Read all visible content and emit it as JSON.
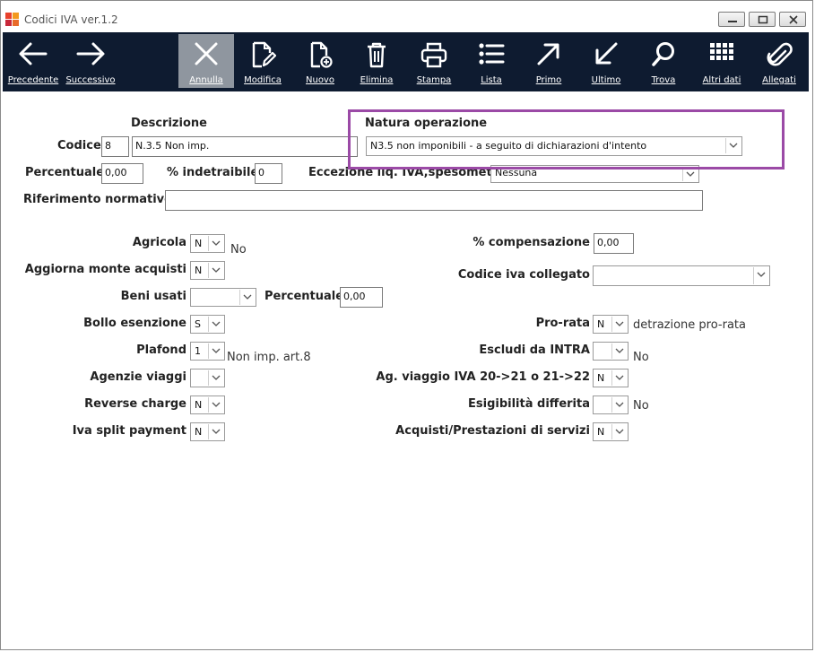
{
  "window": {
    "title": "Codici IVA ver.1.2"
  },
  "toolbar": {
    "precedente": "Precedente",
    "successivo": "Successivo",
    "annulla": "Annulla",
    "modifica": "Modifica",
    "nuovo": "Nuovo",
    "elimina": "Elimina",
    "stampa": "Stampa",
    "lista": "Lista",
    "primo": "Primo",
    "ultimo": "Ultimo",
    "trova": "Trova",
    "altri_dati": "Altri dati",
    "allegati": "Allegati"
  },
  "form": {
    "descrizione_label": "Descrizione",
    "codice_label": "Codice",
    "codice_value": "8",
    "descrizione_value": "N.3.5 Non imp.",
    "natura_label": "Natura operazione",
    "natura_value": "N3.5 non imponibili - a seguito di dichiarazioni d'intento",
    "percentuale_label": "Percentuale",
    "percentuale_value": "0,00",
    "indetraibile_label": "% indetraibile",
    "indetraibile_value": "0",
    "eccezione_label": "Eccezione liq. IVA,spesometro",
    "eccezione_value": "Nessuna",
    "riferimento_label": "Riferimento normativo",
    "riferimento_value": "",
    "agricola_label": "Agricola",
    "agricola_value": "N",
    "agricola_text": "No",
    "aggiorna_label": "Aggiorna monte acquisti",
    "aggiorna_value": "N",
    "beni_label": "Beni usati",
    "beni_value": "",
    "percentuale2_label": "Percentuale",
    "percentuale2_value": "0,00",
    "bollo_label": "Bollo esenzione",
    "bollo_value": "S",
    "plafond_label": "Plafond",
    "plafond_value": "1",
    "plafond_text": "Non imp. art.8",
    "agenzie_label": "Agenzie viaggi",
    "agenzie_value": "",
    "reverse_label": "Reverse charge",
    "reverse_value": "N",
    "split_label": "Iva split payment",
    "split_value": "N",
    "compensazione_label": "% compensazione",
    "compensazione_value": "0,00",
    "collegato_label": "Codice iva collegato",
    "collegato_value": "",
    "prorata_label": "Pro-rata",
    "prorata_value": "N",
    "prorata_text": "detrazione pro-rata",
    "intra_label": "Escludi da INTRA",
    "intra_value": "",
    "intra_text": "No",
    "agviaggio_label": "Ag. viaggio IVA 20->21 o 21->22",
    "agviaggio_value": "N",
    "esigibilita_label": "Esigibilità differita",
    "esigibilita_value": "",
    "esigibilita_text": "No",
    "acquisti_label": "Acquisti/Prestazioni di servizi",
    "acquisti_value": "N"
  },
  "colors": {
    "toolbar_bg": "#0e1b30",
    "active_button": "#8f969f",
    "highlight": "#9b4aa6"
  }
}
